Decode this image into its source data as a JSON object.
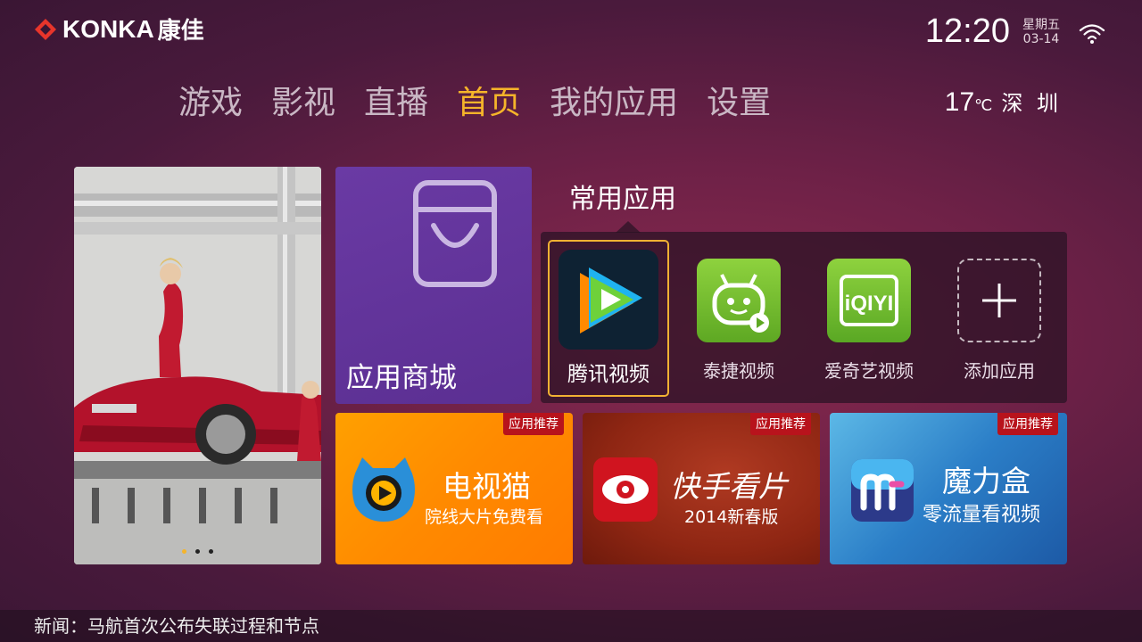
{
  "header": {
    "brand": "KONKA",
    "brand_cn": "康佳",
    "time": "12:20",
    "weekday": "星期五",
    "date": "03-14"
  },
  "nav": {
    "items": [
      {
        "label": "游戏",
        "active": false
      },
      {
        "label": "影视",
        "active": false
      },
      {
        "label": "直播",
        "active": false
      },
      {
        "label": "首页",
        "active": true
      },
      {
        "label": "我的应用",
        "active": false
      },
      {
        "label": "设置",
        "active": false
      }
    ]
  },
  "weather": {
    "temp": "17",
    "unit": "℃",
    "city": "深 圳"
  },
  "banner": {
    "slides": 3,
    "current": 1
  },
  "appstore": {
    "label": "应用商城"
  },
  "common": {
    "title": "常用应用",
    "apps": [
      {
        "name": "腾讯视频",
        "icon": "tencent-video-icon"
      },
      {
        "name": "泰捷视频",
        "icon": "taijie-video-icon"
      },
      {
        "name": "爱奇艺视频",
        "icon": "iqiyi-icon"
      },
      {
        "name": "添加应用",
        "icon": "add-icon"
      }
    ]
  },
  "recommend": {
    "tag": "应用推荐",
    "items": [
      {
        "title": "电视猫",
        "sub": "院线大片免费看"
      },
      {
        "title": "快手看片",
        "sub": "2014新春版"
      },
      {
        "title": "魔力盒",
        "sub": "零流量看视频"
      }
    ]
  },
  "news": {
    "text": "新闻：马航首次公布失联过程和节点"
  },
  "colors": {
    "accent": "#f5b42a",
    "appstore": "#5b2f92",
    "tag": "#b8131c"
  }
}
